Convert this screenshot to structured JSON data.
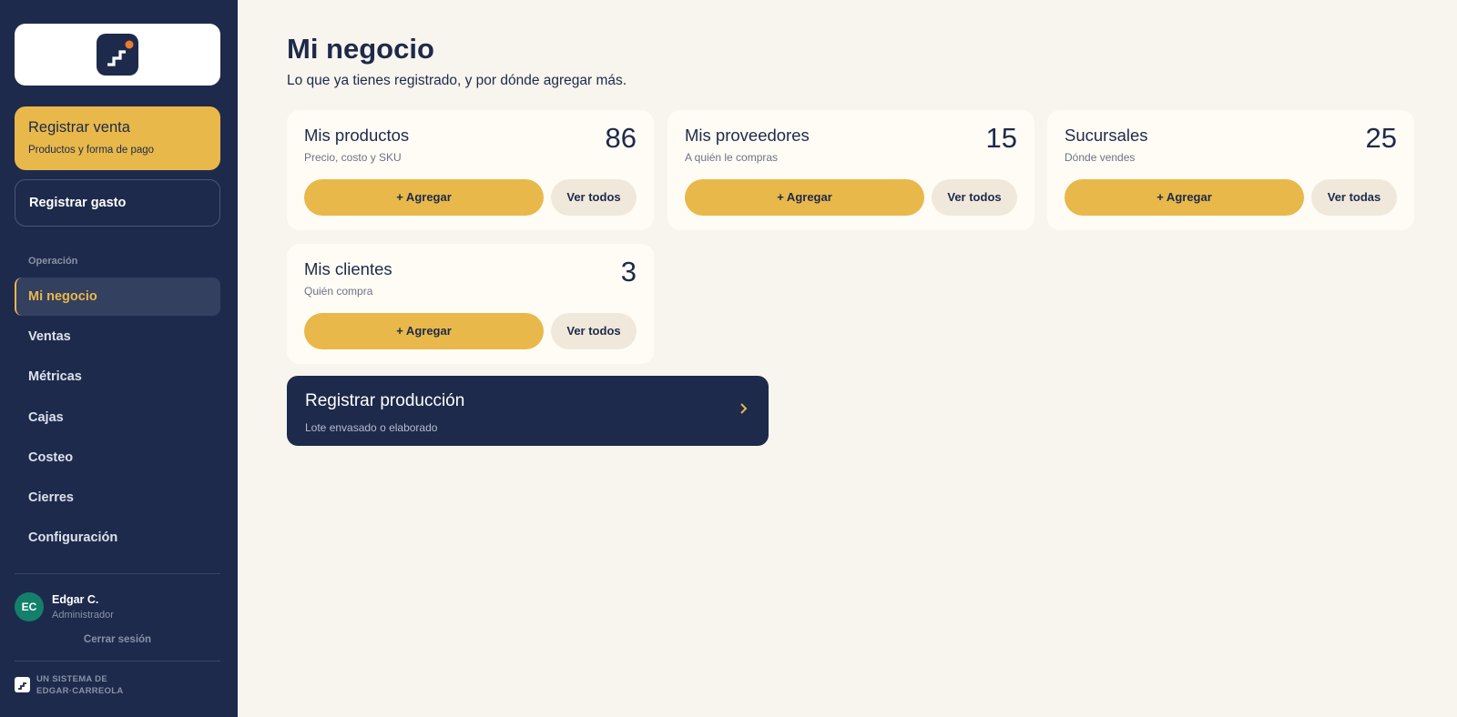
{
  "sidebar": {
    "primary_action": {
      "title": "Registrar venta",
      "subtitle": "Productos y forma de pago"
    },
    "secondary_action": "Registrar gasto",
    "section_label": "Operación",
    "nav": [
      "Mi negocio",
      "Ventas",
      "Métricas",
      "Cajas",
      "Costeo",
      "Cierres",
      "Configuración"
    ],
    "active_index": 0,
    "user": {
      "initials": "EC",
      "name": "Edgar C.",
      "role": "Administrador",
      "logout": "Cerrar sesión"
    },
    "brand": {
      "line1": "UN SISTEMA DE",
      "line2": "EDGAR·CARREOLA"
    }
  },
  "main": {
    "title": "Mi negocio",
    "subtitle": "Lo que ya tienes registrado, y por dónde agregar más.",
    "cards": [
      {
        "title": "Mis productos",
        "subtitle": "Precio, costo y SKU",
        "count": "86",
        "add_label": "+ Agregar",
        "view_label": "Ver todos"
      },
      {
        "title": "Mis proveedores",
        "subtitle": "A quién le compras",
        "count": "15",
        "add_label": "+ Agregar",
        "view_label": "Ver todos"
      },
      {
        "title": "Sucursales",
        "subtitle": "Dónde vendes",
        "count": "25",
        "add_label": "+ Agregar",
        "view_label": "Ver todas"
      },
      {
        "title": "Mis clientes",
        "subtitle": "Quién compra",
        "count": "3",
        "add_label": "+ Agregar",
        "view_label": "Ver todos"
      }
    ],
    "production": {
      "title": "Registrar producción",
      "subtitle": "Lote envasado o elaborado"
    }
  },
  "colors": {
    "navy": "#1e2a4b",
    "accent": "#e8b84a",
    "background": "#f8f4ee",
    "avatar": "#14806c",
    "logo_dot": "#e87d2a"
  },
  "icons": {
    "logo": "stairs-logo-icon",
    "production_arrow": "chevron-right-icon"
  }
}
